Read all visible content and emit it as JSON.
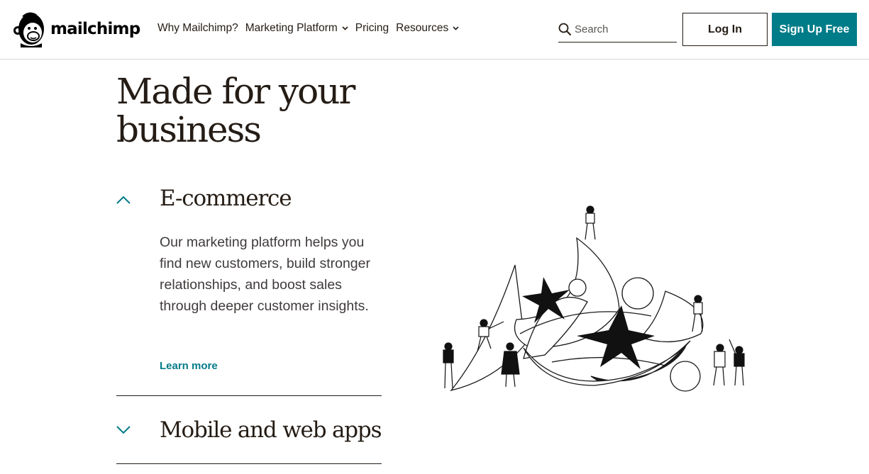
{
  "brand": {
    "name": "mailchimp",
    "accent": "#007c89"
  },
  "nav": {
    "items": [
      {
        "label": "Why Mailchimp?",
        "has_dropdown": false
      },
      {
        "label": "Marketing Platform",
        "has_dropdown": true
      },
      {
        "label": "Pricing",
        "has_dropdown": false
      },
      {
        "label": "Resources",
        "has_dropdown": true
      }
    ]
  },
  "search": {
    "placeholder": "Search",
    "value": ""
  },
  "auth": {
    "login_label": "Log In",
    "signup_label": "Sign Up Free"
  },
  "main": {
    "headline": "Made for your business",
    "accordion": [
      {
        "title": "E-commerce",
        "expanded": true,
        "body": "Our marketing platform helps you find new customers, build stronger relationships, and boost sales through deeper customer insights.",
        "link_label": "Learn more"
      },
      {
        "title": "Mobile and web apps",
        "expanded": false
      }
    ]
  },
  "icons": {
    "logo": "freddie-monkey-logo",
    "search": "search-icon",
    "expanded": "chevron-up-icon",
    "collapsed": "chevron-down-icon",
    "dropdown": "chevron-down-icon"
  }
}
